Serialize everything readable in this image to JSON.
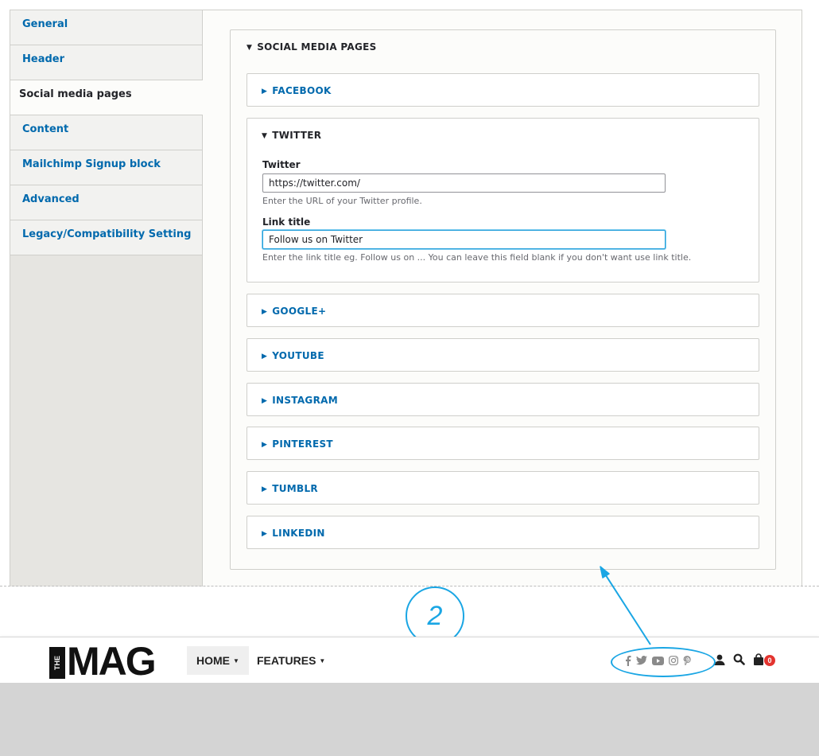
{
  "settings": {
    "vertical_tabs": [
      {
        "label": "General",
        "active": false
      },
      {
        "label": "Header",
        "active": false
      },
      {
        "label": "Social media pages",
        "active": true
      },
      {
        "label": "Content",
        "active": false
      },
      {
        "label": "Mailchimp Signup block",
        "active": false
      },
      {
        "label": "Advanced",
        "active": false
      },
      {
        "label": "Legacy/Compatibility Setting",
        "active": false
      }
    ],
    "panel_title": "SOCIAL MEDIA PAGES",
    "sections": {
      "facebook": "FACEBOOK",
      "twitter": "TWITTER",
      "googleplus": "GOOGLE+",
      "youtube": "YOUTUBE",
      "instagram": "INSTAGRAM",
      "pinterest": "PINTEREST",
      "tumblr": "TUMBLR",
      "linkedin": "LINKEDIN"
    },
    "twitter_form": {
      "url_label": "Twitter",
      "url_value": "https://twitter.com/",
      "url_description": "Enter the URL of your Twitter profile.",
      "title_label": "Link title",
      "title_value": "Follow us on Twitter",
      "title_description": "Enter the link title eg. Follow us on ... You can leave this field blank if you don't want use link title."
    }
  },
  "annotation": {
    "step_number": "2",
    "accent_color": "#1aa6e4"
  },
  "site_header": {
    "logo_small": "THE",
    "logo_main": "MAG",
    "menu": [
      {
        "label": "HOME",
        "active": true
      },
      {
        "label": "FEATURES",
        "active": false
      }
    ],
    "social_icons": [
      "facebook-icon",
      "twitter-icon",
      "youtube-icon",
      "instagram-icon",
      "pinterest-icon"
    ],
    "cart_count": "0",
    "badge_color": "#e3342f"
  },
  "colors": {
    "link_blue": "#0069ad",
    "text_dark": "#232429"
  }
}
